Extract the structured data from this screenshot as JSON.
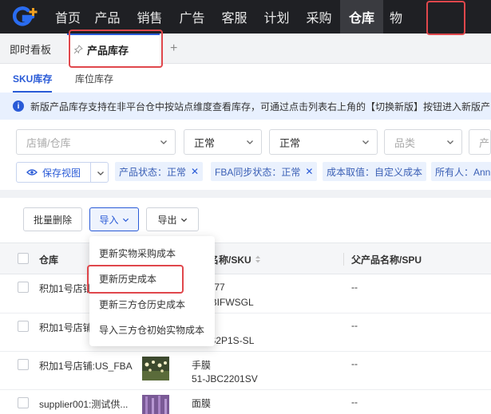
{
  "nav": {
    "items": [
      "首页",
      "产品",
      "销售",
      "广告",
      "客服",
      "计划",
      "采购",
      "仓库",
      "物"
    ],
    "active_index": 7
  },
  "tabs": {
    "items": [
      "即时看板",
      "产品库存"
    ],
    "add": "+"
  },
  "subtabs": [
    "SKU库存",
    "库位库存"
  ],
  "notice": "新版产品库存支持在非平台仓中按站点维度查看库存，可通过点击列表右上角的【切换新版】按钮进入新版产",
  "filters": {
    "store_placeholder": "店铺/仓库",
    "status1": "正常",
    "status2": "正常",
    "category_placeholder": "品类",
    "product_placeholder": "产"
  },
  "save_view": "保存视图",
  "tags": [
    "产品状态：正常",
    "FBA同步状态：正常",
    "成本取值：自定义成本",
    "所有人：Ann"
  ],
  "toolbar": {
    "bulk_delete": "批量删除",
    "import": "导入",
    "export": "导出"
  },
  "table": {
    "headers": [
      "仓库",
      "名称/SKU",
      "父产品名称/SPU"
    ],
    "rows": [
      {
        "warehouse": "积加1号店铺",
        "name": "9977",
        "sku": "HBIFWSGL",
        "spu": "--"
      },
      {
        "warehouse": "积加1号店铺",
        "name": "盾",
        "sku": "TS2P1S-SL",
        "spu": "--"
      },
      {
        "warehouse": "积加1号店铺:US_FBA",
        "name": "手膜",
        "sku": "51-JBC2201SV",
        "spu": "--"
      },
      {
        "warehouse": "supplier001:测试供...",
        "name": "面膜",
        "sku": "",
        "spu": "--"
      }
    ]
  },
  "import_menu": [
    "更新实物采购成本",
    "更新历史成本",
    "更新三方仓历史成本",
    "导入三方仓初始实物成本"
  ],
  "colors": {
    "accent": "#2a5bd7",
    "highlight": "#e0474c",
    "nav_bg": "#1f2024"
  }
}
